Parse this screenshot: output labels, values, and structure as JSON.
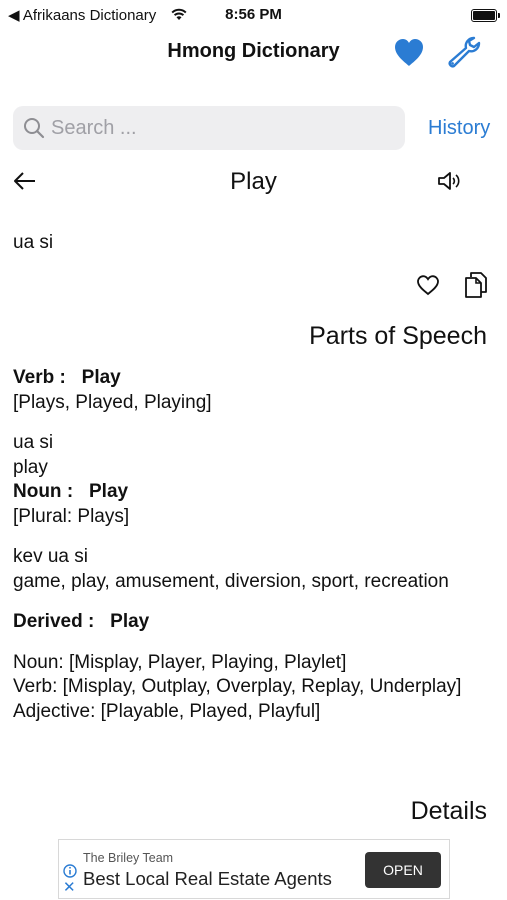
{
  "status_bar": {
    "back_label": "◀ Afrikaans Dictionary",
    "time": "8:56 PM"
  },
  "nav": {
    "title": "Hmong Dictionary",
    "heart_icon": "heart-filled-icon",
    "wrench_icon": "wrench-icon",
    "accent_color": "#2b7cd3"
  },
  "search": {
    "placeholder": "Search ...",
    "value": "",
    "history_label": "History"
  },
  "entry": {
    "word": "Play",
    "translation": "ua si",
    "parts_of_speech_heading": "Parts of Speech",
    "details_heading": "Details",
    "verb": {
      "label": "Verb :",
      "word": "Play",
      "forms": "[Plays, Played, Playing]",
      "translation": "ua si",
      "english": "play"
    },
    "noun": {
      "label": "Noun :",
      "word": "Play",
      "forms": "[Plural: Plays]",
      "translation": "kev ua si",
      "synonyms": "game, play, amusement, diversion, sport, recreation"
    },
    "derived": {
      "label": "Derived :",
      "word": "Play",
      "noun_line": "Noun:  [Misplay, Player, Playing, Playlet]",
      "verb_line": "Verb:  [Misplay, Outplay, Overplay, Replay, Underplay]",
      "adjective_line": "Adjective:  [Playable, Played, Playful]"
    }
  },
  "ad": {
    "sponsor": "The Briley Team",
    "headline": "Best Local Real Estate Agents",
    "button_label": "OPEN"
  }
}
